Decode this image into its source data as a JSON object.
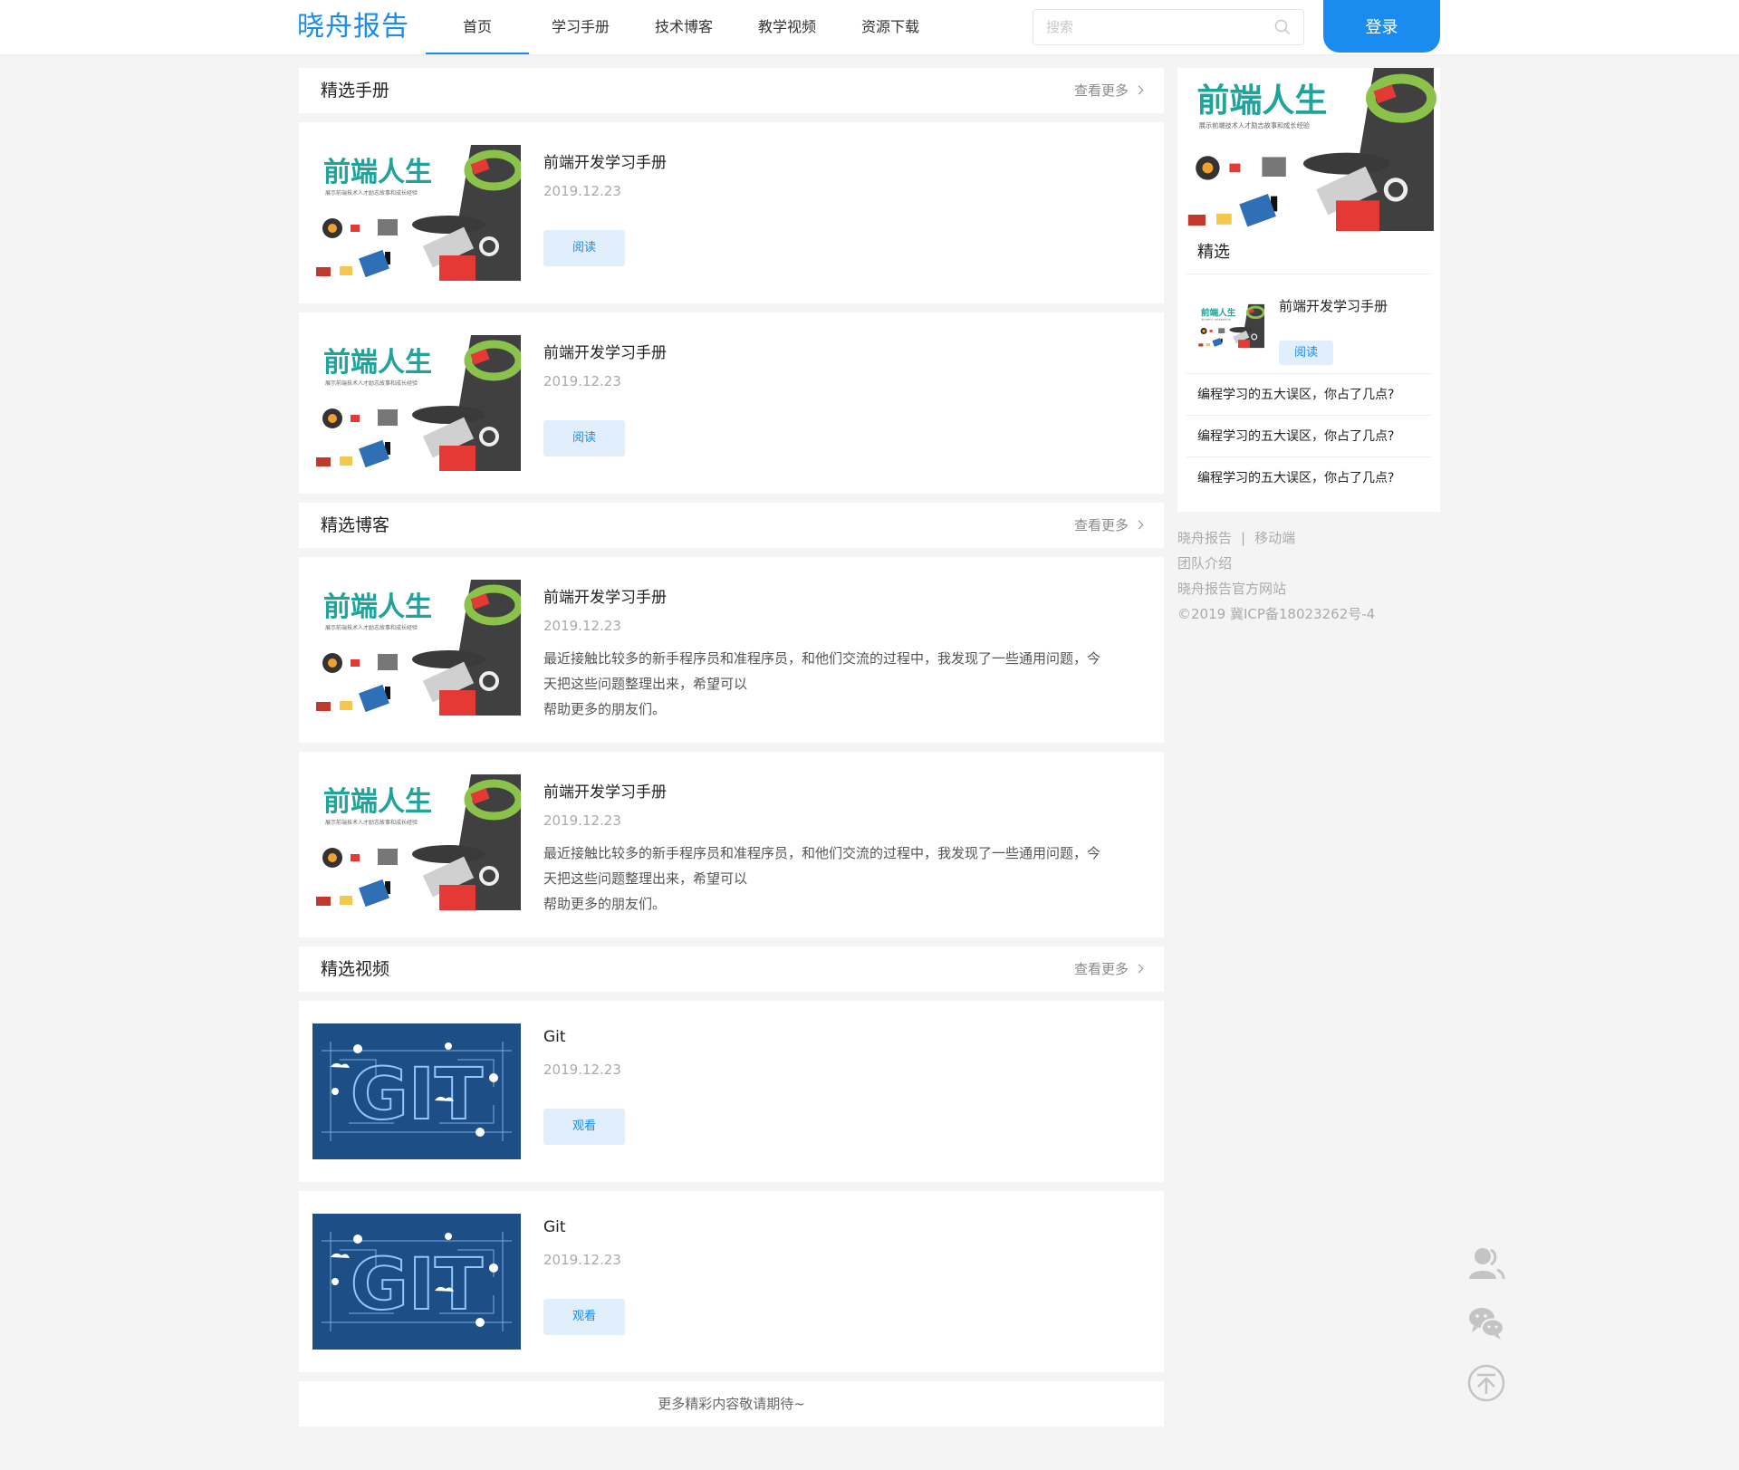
{
  "header": {
    "logo": "晓舟报告",
    "nav": [
      "首页",
      "学习手册",
      "技术博客",
      "教学视频",
      "资源下载"
    ],
    "search_placeholder": "搜索",
    "login_label": "登录"
  },
  "sections": {
    "handbook": {
      "title": "精选手册",
      "more": "查看更多",
      "cards": [
        {
          "title": "前端开发学习手册",
          "date": "2019.12.23",
          "button": "阅读"
        },
        {
          "title": "前端开发学习手册",
          "date": "2019.12.23",
          "button": "阅读"
        }
      ]
    },
    "blog": {
      "title": "精选博客",
      "more": "查看更多",
      "cards": [
        {
          "title": "前端开发学习手册",
          "date": "2019.12.23",
          "desc_line1": "最近接触比较多的新手程序员和准程序员，和他们交流的过程中，我发现了一些通用问题，今",
          "desc_line2": "天把这些问题整理出来，希望可以",
          "desc_line3": "帮助更多的朋友们。"
        },
        {
          "title": "前端开发学习手册",
          "date": "2019.12.23",
          "desc_line1": "最近接触比较多的新手程序员和准程序员，和他们交流的过程中，我发现了一些通用问题，今",
          "desc_line2": "天把这些问题整理出来，希望可以",
          "desc_line3": "帮助更多的朋友们。"
        }
      ]
    },
    "video": {
      "title": "精选视频",
      "more": "查看更多",
      "cards": [
        {
          "title": "Git",
          "date": "2019.12.23",
          "button": "观看"
        },
        {
          "title": "Git",
          "date": "2019.12.23",
          "button": "观看"
        }
      ]
    },
    "footer_text": "更多精彩内容敬请期待~"
  },
  "thumb": {
    "brand_text": "前端人生",
    "brand_sub": "展示前端技术人才励志故事和成长经验",
    "git_text": "GIT"
  },
  "sidebar": {
    "title": "精选",
    "feature": {
      "title": "前端开发学习手册",
      "button": "阅读"
    },
    "items": [
      "编程学习的五大误区，你占了几点?",
      "编程学习的五大误区，你占了几点?",
      "编程学习的五大误区，你占了几点?"
    ],
    "footer": {
      "link1": "晓舟报告",
      "separator": "|",
      "link2": "移动端",
      "team": "团队介绍",
      "site": "晓舟报告官方网站",
      "copyright": "©2019 冀ICP备18023262号-4"
    }
  },
  "colors": {
    "accent": "#1a8cf0",
    "button_bg": "#e1eefb",
    "page_bg": "#f4f4f4",
    "thumb_teal": "#1fa39a",
    "git_bg": "#1d4e86"
  },
  "float_tools": [
    "contact-icon",
    "wechat-icon",
    "back-to-top-icon"
  ]
}
